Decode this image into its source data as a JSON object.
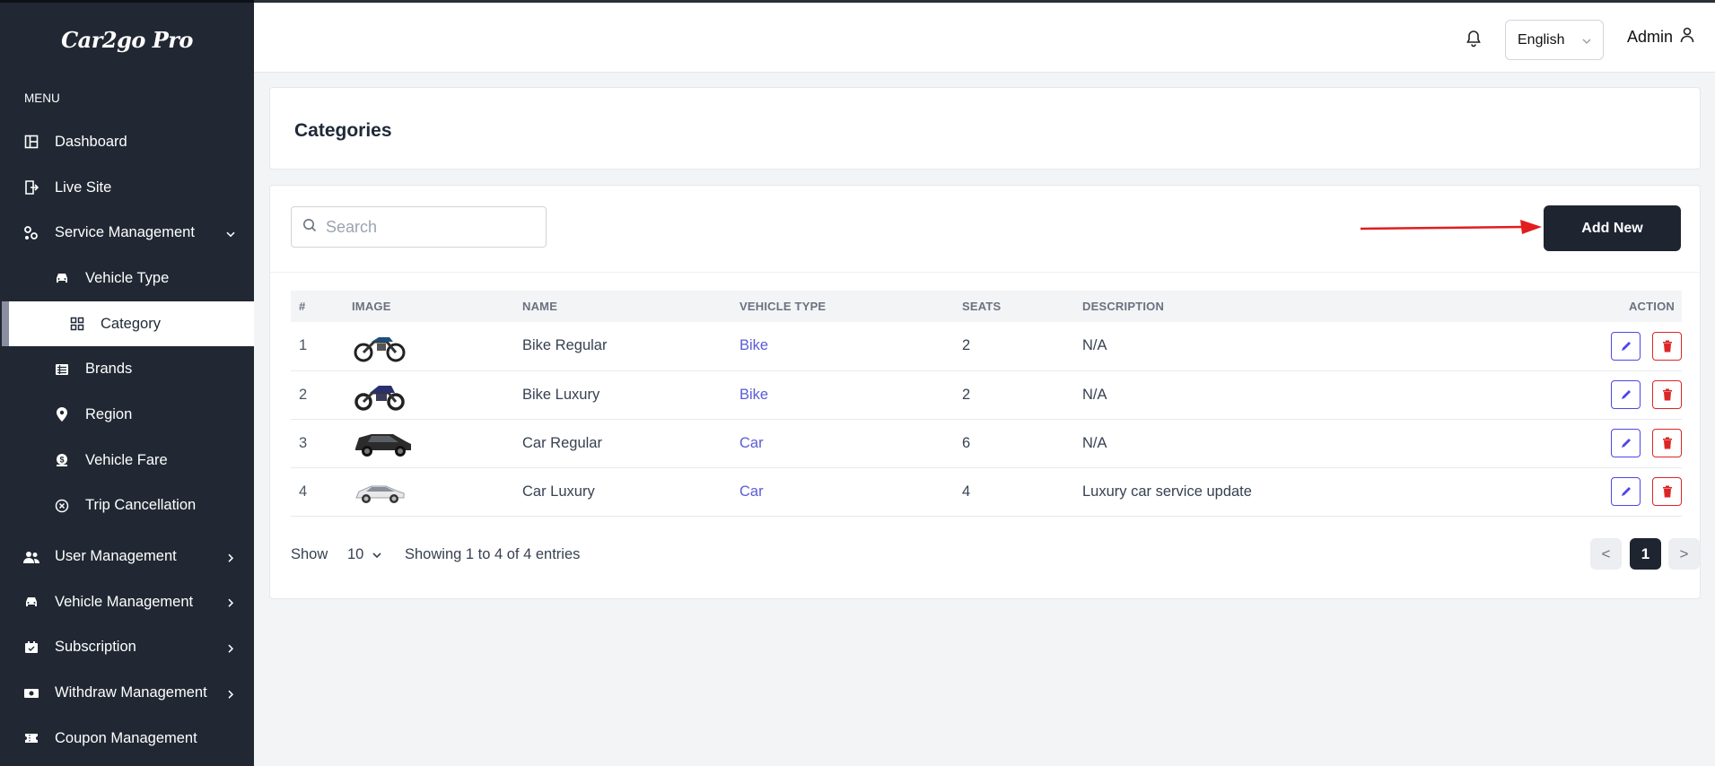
{
  "app": {
    "logo": "Car2go Pro"
  },
  "sidebar": {
    "menu_label": "MENU",
    "items": [
      {
        "label": "Dashboard",
        "icon": "dashboard-icon"
      },
      {
        "label": "Live Site",
        "icon": "live-site-icon"
      },
      {
        "label": "Service Management",
        "icon": "cogs-icon",
        "expanded": true
      },
      {
        "label": "Vehicle Type",
        "icon": "car-icon"
      },
      {
        "label": "Category",
        "icon": "grid-icon",
        "active": true
      },
      {
        "label": "Brands",
        "icon": "list-icon"
      },
      {
        "label": "Region",
        "icon": "map-pin-icon"
      },
      {
        "label": "Vehicle Fare",
        "icon": "fare-icon"
      },
      {
        "label": "Trip Cancellation",
        "icon": "cancel-icon"
      },
      {
        "label": "User Management",
        "icon": "users-icon"
      },
      {
        "label": "Vehicle Management",
        "icon": "car-icon"
      },
      {
        "label": "Subscription",
        "icon": "subscription-icon"
      },
      {
        "label": "Withdraw Management",
        "icon": "money-icon"
      },
      {
        "label": "Coupon Management",
        "icon": "ticket-icon"
      }
    ]
  },
  "header": {
    "language": "English",
    "user": "Admin"
  },
  "page": {
    "title": "Categories",
    "search_placeholder": "Search",
    "add_button": "Add New"
  },
  "table": {
    "columns": [
      "#",
      "IMAGE",
      "NAME",
      "VEHICLE TYPE",
      "SEATS",
      "DESCRIPTION",
      "ACTION"
    ],
    "rows": [
      {
        "index": "1",
        "image": "blue-motorbike",
        "name": "Bike Regular",
        "vehicle_type": "Bike",
        "seats": "2",
        "description": "N/A"
      },
      {
        "index": "2",
        "image": "sport-motorbike",
        "name": "Bike Luxury",
        "vehicle_type": "Bike",
        "seats": "2",
        "description": "N/A"
      },
      {
        "index": "3",
        "image": "black-suv",
        "name": "Car Regular",
        "vehicle_type": "Car",
        "seats": "6",
        "description": "N/A"
      },
      {
        "index": "4",
        "image": "white-sedan",
        "name": "Car Luxury",
        "vehicle_type": "Car",
        "seats": "4",
        "description": "Luxury car service update"
      }
    ]
  },
  "pagination": {
    "show_label": "Show",
    "per_page": "10",
    "summary": "Showing 1 to 4 of 4 entries",
    "prev": "<",
    "current": "1",
    "next": ">"
  },
  "colors": {
    "sidebar_bg": "#212833",
    "primary_button": "#1e2530",
    "link": "#5b5bd6",
    "edit": "#4f46e5",
    "delete": "#dc2626",
    "annotation_arrow": "#e11d1d"
  }
}
